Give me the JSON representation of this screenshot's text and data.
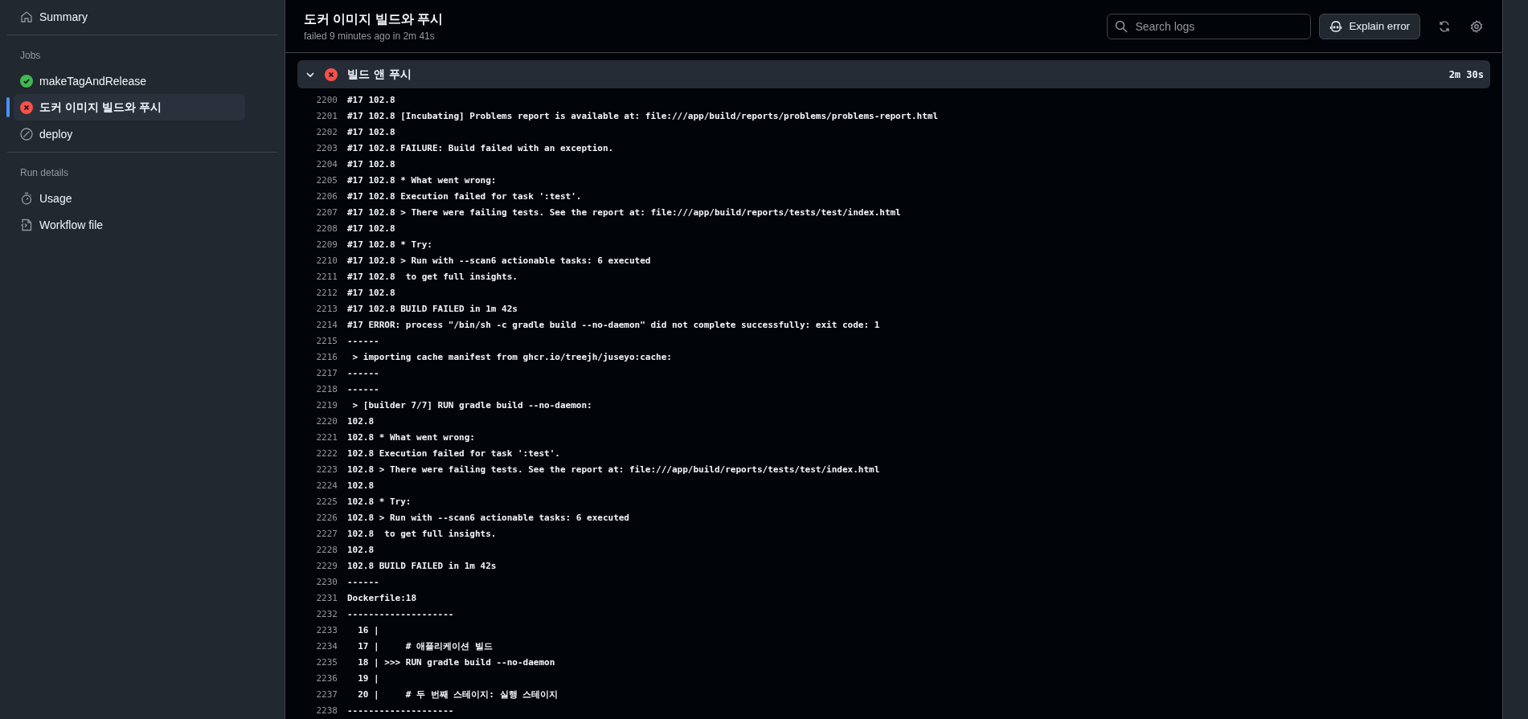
{
  "sidebar": {
    "summary": {
      "label": "Summary"
    },
    "sections": [
      {
        "title": "Jobs",
        "items": [
          {
            "label": "makeTagAndRelease",
            "kind": "success",
            "selected": false
          },
          {
            "label": "도커 이미지 빌드와 푸시",
            "kind": "failure",
            "selected": true
          },
          {
            "label": "deploy",
            "kind": "skipped",
            "selected": false
          }
        ]
      },
      {
        "title": "Run details",
        "items": [
          {
            "label": "Usage",
            "kind": "usage",
            "selected": false
          },
          {
            "label": "Workflow file",
            "kind": "file",
            "selected": false
          }
        ]
      }
    ]
  },
  "header": {
    "title": "도커 이미지 빌드와 푸시",
    "subtitle": "failed 9 minutes ago in 2m 41s",
    "search": {
      "placeholder": "Search logs"
    },
    "explain_button": "Explain error"
  },
  "step": {
    "title": "빌드 앤 푸시",
    "kind": "failure",
    "expanded": true,
    "duration": "2m 30s"
  },
  "log": [
    {
      "number": "2200",
      "text": "#17 102.8"
    },
    {
      "number": "2201",
      "text": "#17 102.8 [Incubating] Problems report is available at: file:///app/build/reports/problems/problems-report.html"
    },
    {
      "number": "2202",
      "text": "#17 102.8"
    },
    {
      "number": "2203",
      "text": "#17 102.8 FAILURE: Build failed with an exception."
    },
    {
      "number": "2204",
      "text": "#17 102.8"
    },
    {
      "number": "2205",
      "text": "#17 102.8 * What went wrong:"
    },
    {
      "number": "2206",
      "text": "#17 102.8 Execution failed for task ':test'."
    },
    {
      "number": "2207",
      "text": "#17 102.8 > There were failing tests. See the report at: file:///app/build/reports/tests/test/index.html"
    },
    {
      "number": "2208",
      "text": "#17 102.8"
    },
    {
      "number": "2209",
      "text": "#17 102.8 * Try:"
    },
    {
      "number": "2210",
      "text": "#17 102.8 > Run with --scan6 actionable tasks: 6 executed"
    },
    {
      "number": "2211",
      "text": "#17 102.8  to get full insights."
    },
    {
      "number": "2212",
      "text": "#17 102.8"
    },
    {
      "number": "2213",
      "text": "#17 102.8 BUILD FAILED in 1m 42s"
    },
    {
      "number": "2214",
      "text": "#17 ERROR: process \"/bin/sh -c gradle build --no-daemon\" did not complete successfully: exit code: 1"
    },
    {
      "number": "2215",
      "text": "------"
    },
    {
      "number": "2216",
      "text": " > importing cache manifest from ghcr.io/treejh/juseyo:cache:"
    },
    {
      "number": "2217",
      "text": "------"
    },
    {
      "number": "2218",
      "text": "------"
    },
    {
      "number": "2219",
      "text": " > [builder 7/7] RUN gradle build --no-daemon:"
    },
    {
      "number": "2220",
      "text": "102.8"
    },
    {
      "number": "2221",
      "text": "102.8 * What went wrong:"
    },
    {
      "number": "2222",
      "text": "102.8 Execution failed for task ':test'."
    },
    {
      "number": "2223",
      "text": "102.8 > There were failing tests. See the report at: file:///app/build/reports/tests/test/index.html"
    },
    {
      "number": "2224",
      "text": "102.8"
    },
    {
      "number": "2225",
      "text": "102.8 * Try:"
    },
    {
      "number": "2226",
      "text": "102.8 > Run with --scan6 actionable tasks: 6 executed"
    },
    {
      "number": "2227",
      "text": "102.8  to get full insights."
    },
    {
      "number": "2228",
      "text": "102.8"
    },
    {
      "number": "2229",
      "text": "102.8 BUILD FAILED in 1m 42s"
    },
    {
      "number": "2230",
      "text": "------"
    },
    {
      "number": "2231",
      "text": "Dockerfile:18"
    },
    {
      "number": "2232",
      "text": "--------------------"
    },
    {
      "number": "2233",
      "text": "  16 |"
    },
    {
      "number": "2234",
      "text": "  17 |     # 애플리케이션 빌드"
    },
    {
      "number": "2235",
      "text": "  18 | >>> RUN gradle build --no-daemon"
    },
    {
      "number": "2236",
      "text": "  19 |"
    },
    {
      "number": "2237",
      "text": "  20 |     # 두 번째 스테이지: 실행 스테이지"
    },
    {
      "number": "2238",
      "text": "--------------------"
    }
  ]
}
